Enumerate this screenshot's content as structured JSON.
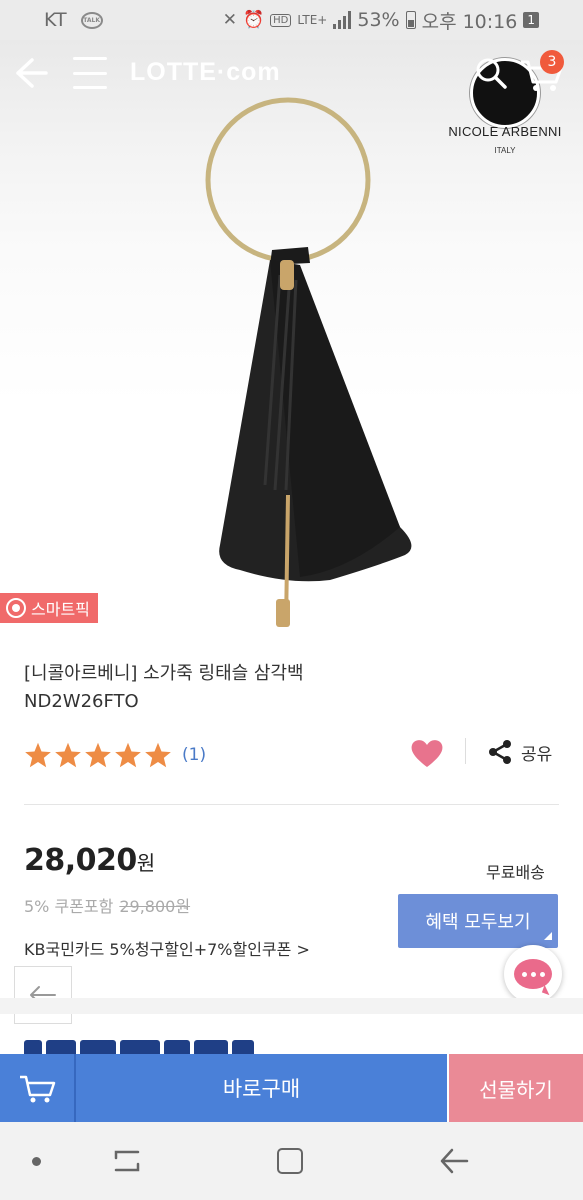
{
  "status_bar": {
    "carrier": "KT",
    "talk_badge": "TALK",
    "hd": "HD",
    "network": "LTE+",
    "battery_percent": "53%",
    "time": "오후 10:16",
    "notification_count": "1"
  },
  "header": {
    "logo": "LOTTE·com",
    "cart_count": "3"
  },
  "brand_logo": {
    "name": "NICOLE ARBENNI",
    "origin": "ITALY"
  },
  "product": {
    "badge": "스마트픽",
    "title": "[니콜아르베니] 소가죽 링태슬 삼각백 ND2W26FTO",
    "rating": 5,
    "review_count": "(1)",
    "share_label": "공유",
    "price_value": "28,020",
    "price_unit": "원",
    "shipping": "무료배송",
    "coupon_label": "5% 쿠폰포함",
    "original_price": "29,800원",
    "benefit_button": "혜택 모두보기",
    "card_promo": "KB국민카드 5%청구할인+7%할인쿠폰 >"
  },
  "bottom_bar": {
    "buy_label": "바로구매",
    "gift_label": "선물하기"
  },
  "colors": {
    "primary_blue": "#4a80d8",
    "gift_pink": "#ea8a96",
    "star_orange": "#ee8c45",
    "heart_pink": "#e8738d",
    "smartpick_red": "#f06a6a"
  }
}
